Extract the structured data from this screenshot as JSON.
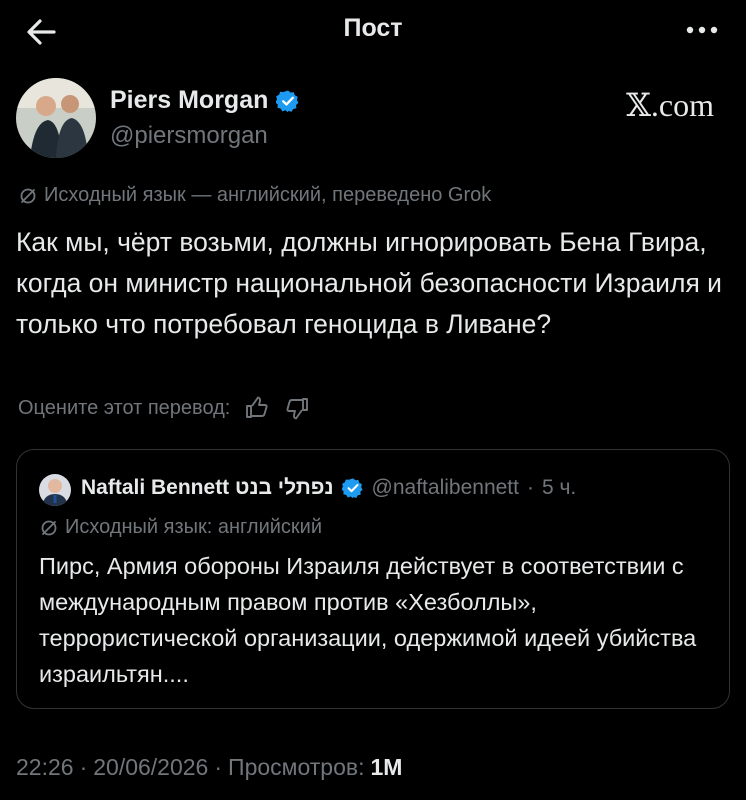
{
  "header": {
    "title": "Пост"
  },
  "author": {
    "name": "Piers Morgan",
    "handle": "@piersmorgan",
    "brand": "𝕏.com"
  },
  "post": {
    "translation_note": "Исходный язык — английский, переведено Grok",
    "text": "Как мы, чёрт возьми, должны игнорировать Бена Гвира, когда он министр национальной безопасности Израиля и только что потребовал геноцида в Ливане?",
    "rate_prompt": "Оцените этот перевод:"
  },
  "quote": {
    "name": "Naftali Bennett נפתלי בנט",
    "handle": "@naftalibennett",
    "sep": "·",
    "time": "5 ч.",
    "translation_note": "Исходный язык: английский",
    "text": "Пирс, Армия обороны Израиля действует в соответствии с международным правом против «Хезболлы», террористической организации, одержимой идеей убийства израильтян...."
  },
  "footer": {
    "time": "22:26",
    "date": "20/06/2026",
    "views_label": "Просмотров:",
    "views_count": "1M",
    "sep": "·"
  },
  "icons": {
    "verified_color": "#1d9bf0",
    "verified": "verified-badge-icon",
    "translate": "translate-icon",
    "thumbs_up": "thumbs-up-icon",
    "thumbs_down": "thumbs-down-icon",
    "back": "back-arrow-icon",
    "more": "more-icon"
  }
}
